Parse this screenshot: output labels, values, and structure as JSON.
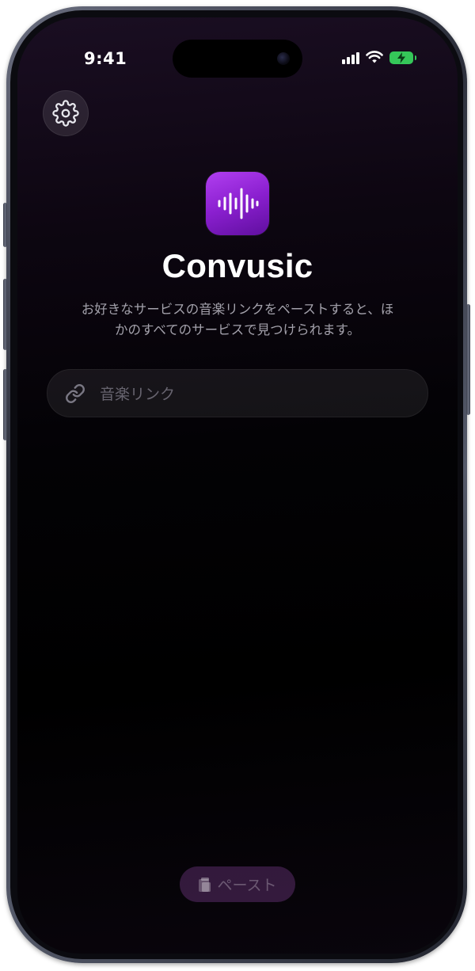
{
  "status_bar": {
    "time": "9:41"
  },
  "settings": {
    "icon": "gear-icon"
  },
  "app": {
    "icon": "waveform-icon",
    "name": "Convusic",
    "description": "お好きなサービスの音楽リンクをペーストすると、ほかのすべてのサービスで見つけられます。"
  },
  "link_field": {
    "icon": "link-icon",
    "value": "",
    "placeholder": "音楽リンク"
  },
  "paste_button": {
    "icon": "clipboard-icon",
    "label": "ペースト"
  },
  "colors": {
    "accent": "#9b2ee0",
    "battery": "#35c759",
    "background": "#000000"
  }
}
